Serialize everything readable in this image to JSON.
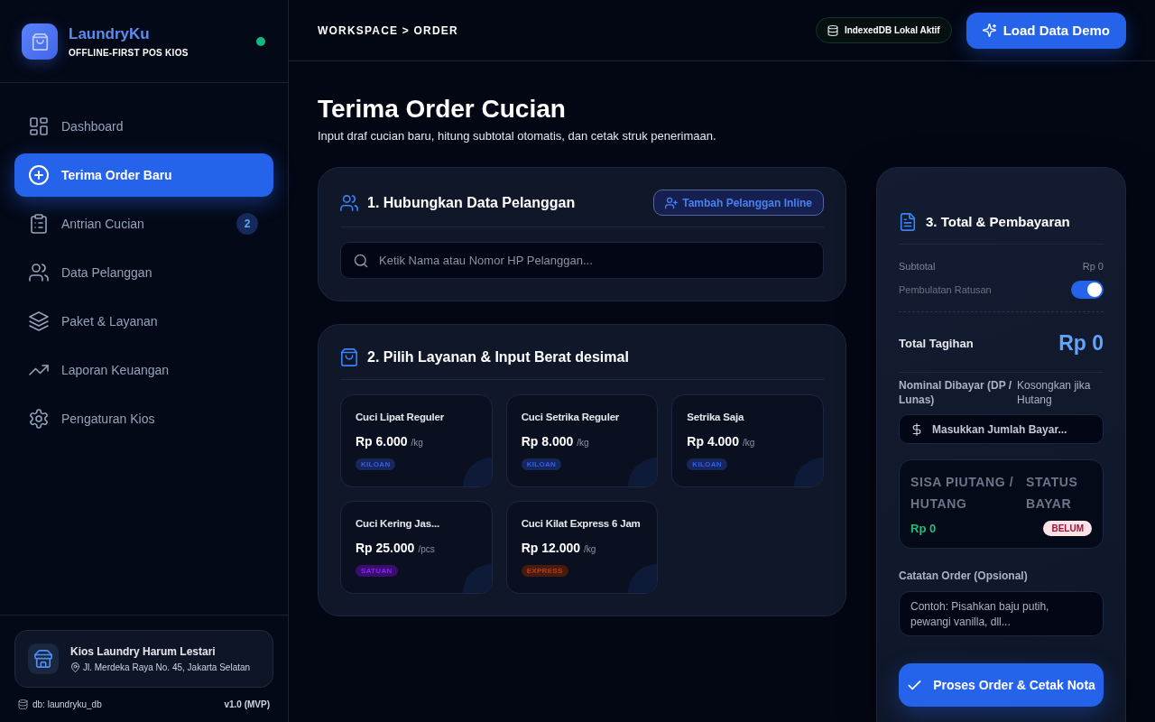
{
  "sidebar": {
    "brand": {
      "name": "LaundryKu",
      "tagline": "OFFLINE-FIRST POS KIOS",
      "online": true
    },
    "nav": [
      {
        "label": "Dashboard",
        "selected": false
      },
      {
        "label": "Terima Order Baru",
        "selected": true
      },
      {
        "label": "Antrian Cucian",
        "selected": false,
        "badge": "2"
      },
      {
        "label": "Data Pelanggan",
        "selected": false
      },
      {
        "label": "Paket & Layanan",
        "selected": false
      },
      {
        "label": "Laporan Keuangan",
        "selected": false
      },
      {
        "label": "Pengaturan Kios",
        "selected": false
      }
    ],
    "store": {
      "name": "Kios Laundry Harum Lestari",
      "address": "Jl. Merdeka Raya No. 45, Jakarta Selatan"
    },
    "footer": {
      "database": "db: laundryku_db",
      "version": "v1.0 (MVP)"
    }
  },
  "top_bar": {
    "breadcrumb": "WORKSPACE > ORDER",
    "storage_status": "IndexedDB Lokal Aktif",
    "demo_button": "Load Data Demo"
  },
  "page": {
    "title": "Terima Order Cucian",
    "subtitle": "Input draf cucian baru, hitung subtotal otomatis, dan cetak struk penerimaan."
  },
  "customer_section": {
    "title": "1. Hubungkan Data Pelanggan",
    "add_button": "Tambah Pelanggan Inline",
    "search": {
      "placeholder": "Ketik Nama atau Nomor HP Pelanggan..."
    }
  },
  "service_section": {
    "title": "2. Pilih Layanan & Input Berat desimal",
    "services": [
      {
        "name": "Cuci Lipat Reguler",
        "price": "Rp 6.000",
        "unit": "/kg",
        "tag": "KILOAN",
        "color": "#16275e",
        "selected": false
      },
      {
        "name": "Cuci Setrika Reguler",
        "price": "Rp 8.000",
        "unit": "/kg",
        "tag": "KILOAN",
        "color": "#16275e",
        "selected": false
      },
      {
        "name": "Setrika Saja",
        "price": "Rp 4.000",
        "unit": "/kg",
        "tag": "KILOAN",
        "color": "#16275e",
        "selected": false
      },
      {
        "name": "Cuci Kering Jas...",
        "price": "Rp 25.000",
        "unit": "/pcs",
        "tag": "SATUAN",
        "color": "#3b0d6e",
        "selected": false
      },
      {
        "name": "Cuci Kilat Express 6 Jam",
        "price": "Rp 12.000",
        "unit": "/kg",
        "tag": "EXPRESS",
        "color": "#4a1a0c",
        "selected": false
      }
    ]
  },
  "payment_panel": {
    "title": "3. Total & Pembayaran",
    "subtotal": {
      "label": "Subtotal",
      "value": "Rp 0"
    },
    "rounding": {
      "label": "Pembulatan Ratusan",
      "on": true
    },
    "total": {
      "label": "Total Tagihan",
      "value": "Rp 0"
    },
    "paid": {
      "label": "Nominal Dibayar (DP / Lunas)",
      "hint": "Kosongkan jika Hutang",
      "placeholder": "Masukkan Jumlah Bayar..."
    },
    "balance": {
      "label": "SISA PIUTANG / HUTANG",
      "value": "Rp 0"
    },
    "status": {
      "label": "STATUS BAYAR",
      "value": "BELUM"
    },
    "notes": {
      "label": "Catatan Order (Opsional)",
      "placeholder": "Contoh: Pisahkan baju putih, pewangi vanilla, dll..."
    },
    "submit_button": "Proses Order & Cetak Nota"
  }
}
